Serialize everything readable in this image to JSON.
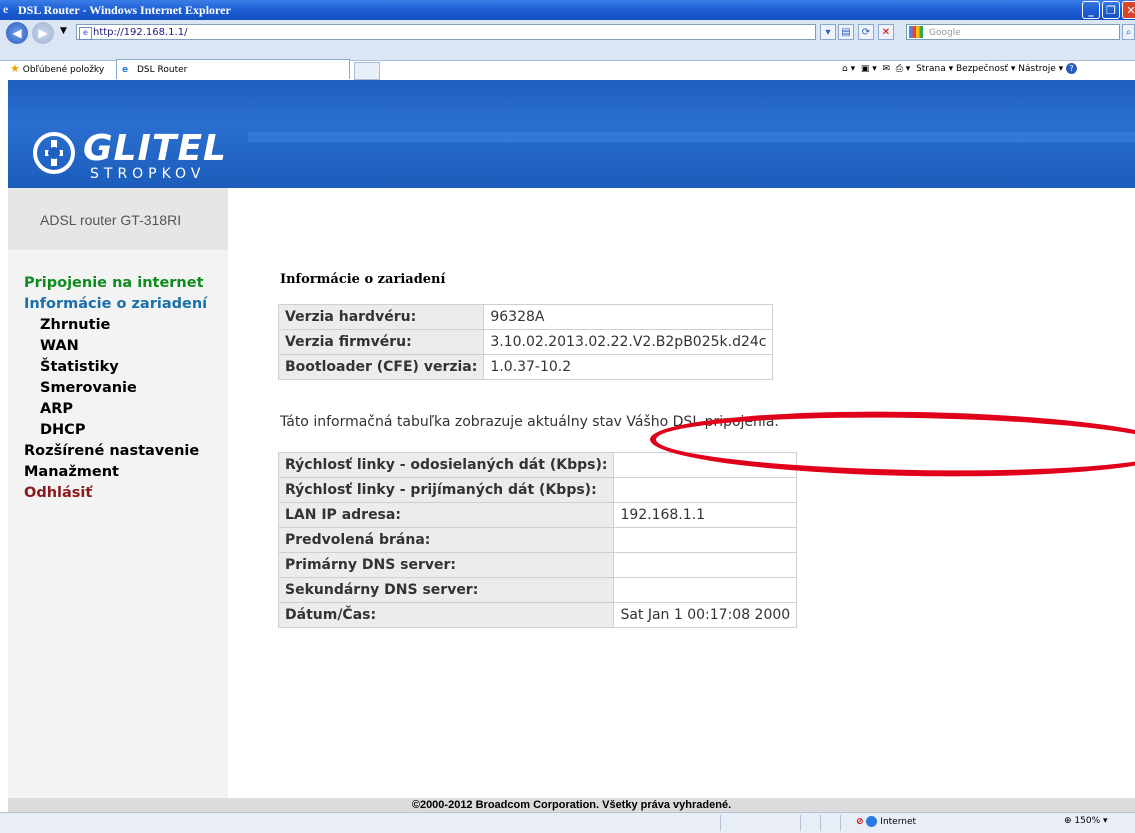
{
  "browser": {
    "title": "DSL Router - Windows Internet Explorer",
    "url": "http://192.168.1.1/",
    "search_placeholder": "Google",
    "favorites_label": "Obľúbené položky",
    "tab_title": "DSL Router",
    "commands": "Strana ▾  Bezpečnosť ▾  Nástroje ▾",
    "status_zone": "Internet",
    "zoom": "150%"
  },
  "header": {
    "logo_text": "GLITEL",
    "logo_sub": "STROPKOV"
  },
  "sidebar": {
    "model": "ADSL router GT-318RI",
    "menu": [
      {
        "label": "Pripojenie na internet"
      },
      {
        "label": "Informácie o zariadení"
      },
      {
        "label": "Zhrnutie"
      },
      {
        "label": "WAN"
      },
      {
        "label": "Štatistiky"
      },
      {
        "label": "Smerovanie"
      },
      {
        "label": "ARP"
      },
      {
        "label": "DHCP"
      },
      {
        "label": "Rozšírené nastavenie"
      },
      {
        "label": "Manažment"
      },
      {
        "label": "Odhlásiť"
      }
    ]
  },
  "main": {
    "title": "Informácie o zariadení",
    "device_table": [
      {
        "label": "Verzia hardvéru:",
        "value": "96328A"
      },
      {
        "label": "Verzia firmvéru:",
        "value": "3.10.02.2013.02.22.V2.B2pB025k.d24c"
      },
      {
        "label": "Bootloader (CFE) verzia:",
        "value": "1.0.37-10.2"
      }
    ],
    "description": "Táto informačná tabuľka zobrazuje aktuálny stav Vášho DSL pripojenia.",
    "status_table": [
      {
        "label": "Rýchlosť linky - odosielaných dát (Kbps):",
        "value": ""
      },
      {
        "label": "Rýchlosť linky - prijímaných dát (Kbps):",
        "value": ""
      },
      {
        "label": "LAN IP adresa:",
        "value": "192.168.1.1"
      },
      {
        "label": "Predvolená brána:",
        "value": ""
      },
      {
        "label": "Primárny DNS server:",
        "value": ""
      },
      {
        "label": "Sekundárny DNS server:",
        "value": ""
      },
      {
        "label": "Dátum/Čas:",
        "value": "Sat Jan 1 00:17:08 2000"
      }
    ]
  },
  "footer": {
    "copyright": "©2000-2012 Broadcom Corporation. Všetky práva vyhradené."
  },
  "colors": {
    "header_blue": "#1e5fbf",
    "menu_green": "#0f8a1e",
    "menu_blue": "#1a70a8",
    "logout_red": "#8b1a1a",
    "highlight_red": "#e0001a"
  }
}
